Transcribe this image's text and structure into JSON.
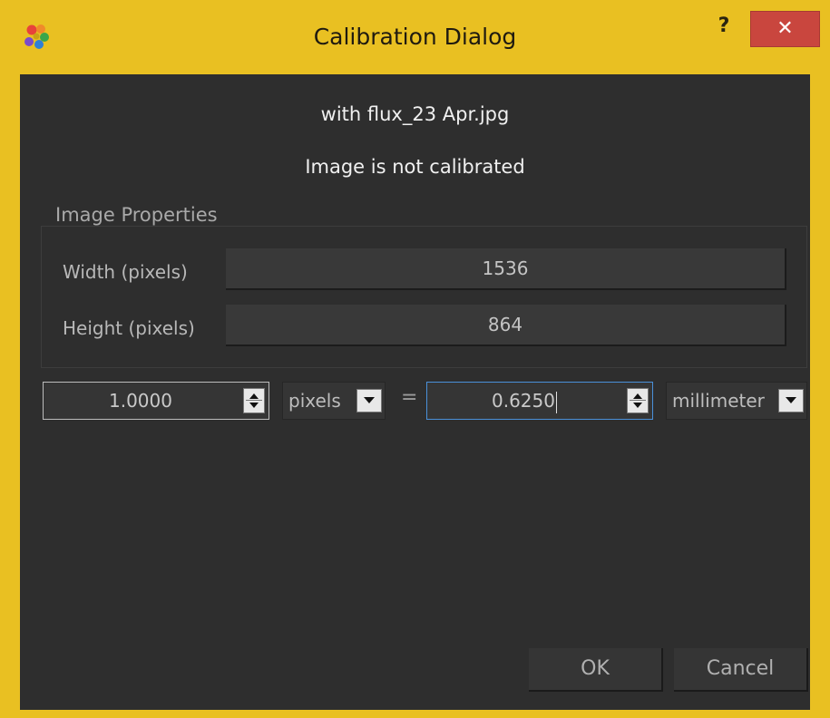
{
  "window": {
    "title": "Calibration Dialog",
    "help_label": "?",
    "close_label": "✕"
  },
  "header": {
    "file_name": "with flux_23 Apr.jpg",
    "status": "Image is not calibrated"
  },
  "image_properties": {
    "title": "Image Properties",
    "width_label": "Width (pixels)",
    "width_value": "1536",
    "height_label": "Height (pixels)",
    "height_value": "864"
  },
  "calibration": {
    "left_value": "1.0000",
    "left_unit": "pixels",
    "equals": "=",
    "right_value": "0.6250",
    "right_unit": "millimeter"
  },
  "buttons": {
    "ok": "OK",
    "cancel": "Cancel"
  },
  "colors": {
    "frame_accent": "#e9c022",
    "close_button": "#c9463e",
    "focus_border": "#4a90d9",
    "client_background": "#2e2e2e"
  }
}
